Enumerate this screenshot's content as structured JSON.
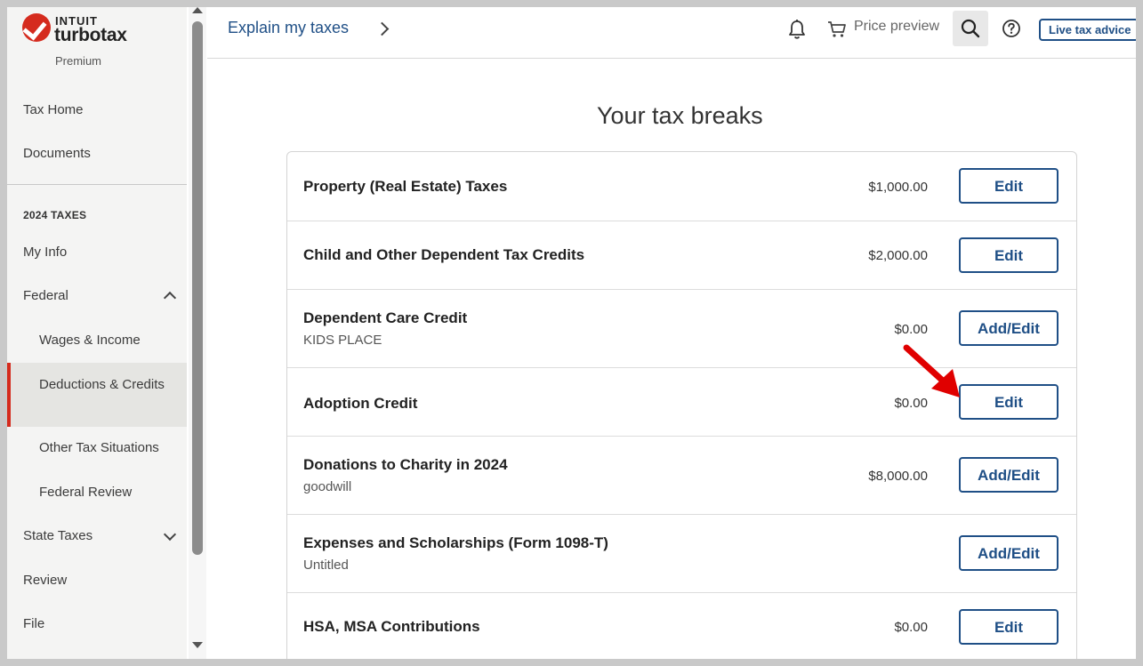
{
  "app": {
    "brand_top": "INTUIT",
    "brand_name": "turbotax",
    "edition": "Premium"
  },
  "sidebar": {
    "items": [
      {
        "label": "Tax Home"
      },
      {
        "label": "Documents"
      },
      {
        "label": "2024 TAXES"
      },
      {
        "label": "My Info"
      },
      {
        "label": "Federal"
      },
      {
        "label": "Wages & Income"
      },
      {
        "label": "Deductions & Credits"
      },
      {
        "label": "Other Tax Situations"
      },
      {
        "label": "Federal Review"
      },
      {
        "label": "State Taxes"
      },
      {
        "label": "Review"
      },
      {
        "label": "File"
      }
    ],
    "active": "Deductions & Credits"
  },
  "header": {
    "breadcrumb": "Explain my taxes",
    "price_preview": "Price preview",
    "live_advice": "Live tax advice"
  },
  "main": {
    "title": "Your tax breaks",
    "rows": [
      {
        "title": "Property (Real Estate) Taxes",
        "subtitle": "",
        "amount": "$1,000.00",
        "button": "Edit"
      },
      {
        "title": "Child and Other Dependent Tax Credits",
        "subtitle": "",
        "amount": "$2,000.00",
        "button": "Edit"
      },
      {
        "title": "Dependent Care Credit",
        "subtitle": "KIDS PLACE",
        "amount": "$0.00",
        "button": "Add/Edit"
      },
      {
        "title": "Adoption Credit",
        "subtitle": "",
        "amount": "$0.00",
        "button": "Edit"
      },
      {
        "title": "Donations to Charity in 2024",
        "subtitle": "goodwill",
        "amount": "$8,000.00",
        "button": "Add/Edit"
      },
      {
        "title": "Expenses and Scholarships (Form 1098-T)",
        "subtitle": "Untitled",
        "amount": "",
        "button": "Add/Edit"
      },
      {
        "title": "HSA, MSA Contributions",
        "subtitle": "",
        "amount": "$0.00",
        "button": "Edit"
      }
    ]
  },
  "colors": {
    "brand_red": "#d52b1e",
    "link_blue": "#1f4f86",
    "annotation_red": "#e00000"
  }
}
